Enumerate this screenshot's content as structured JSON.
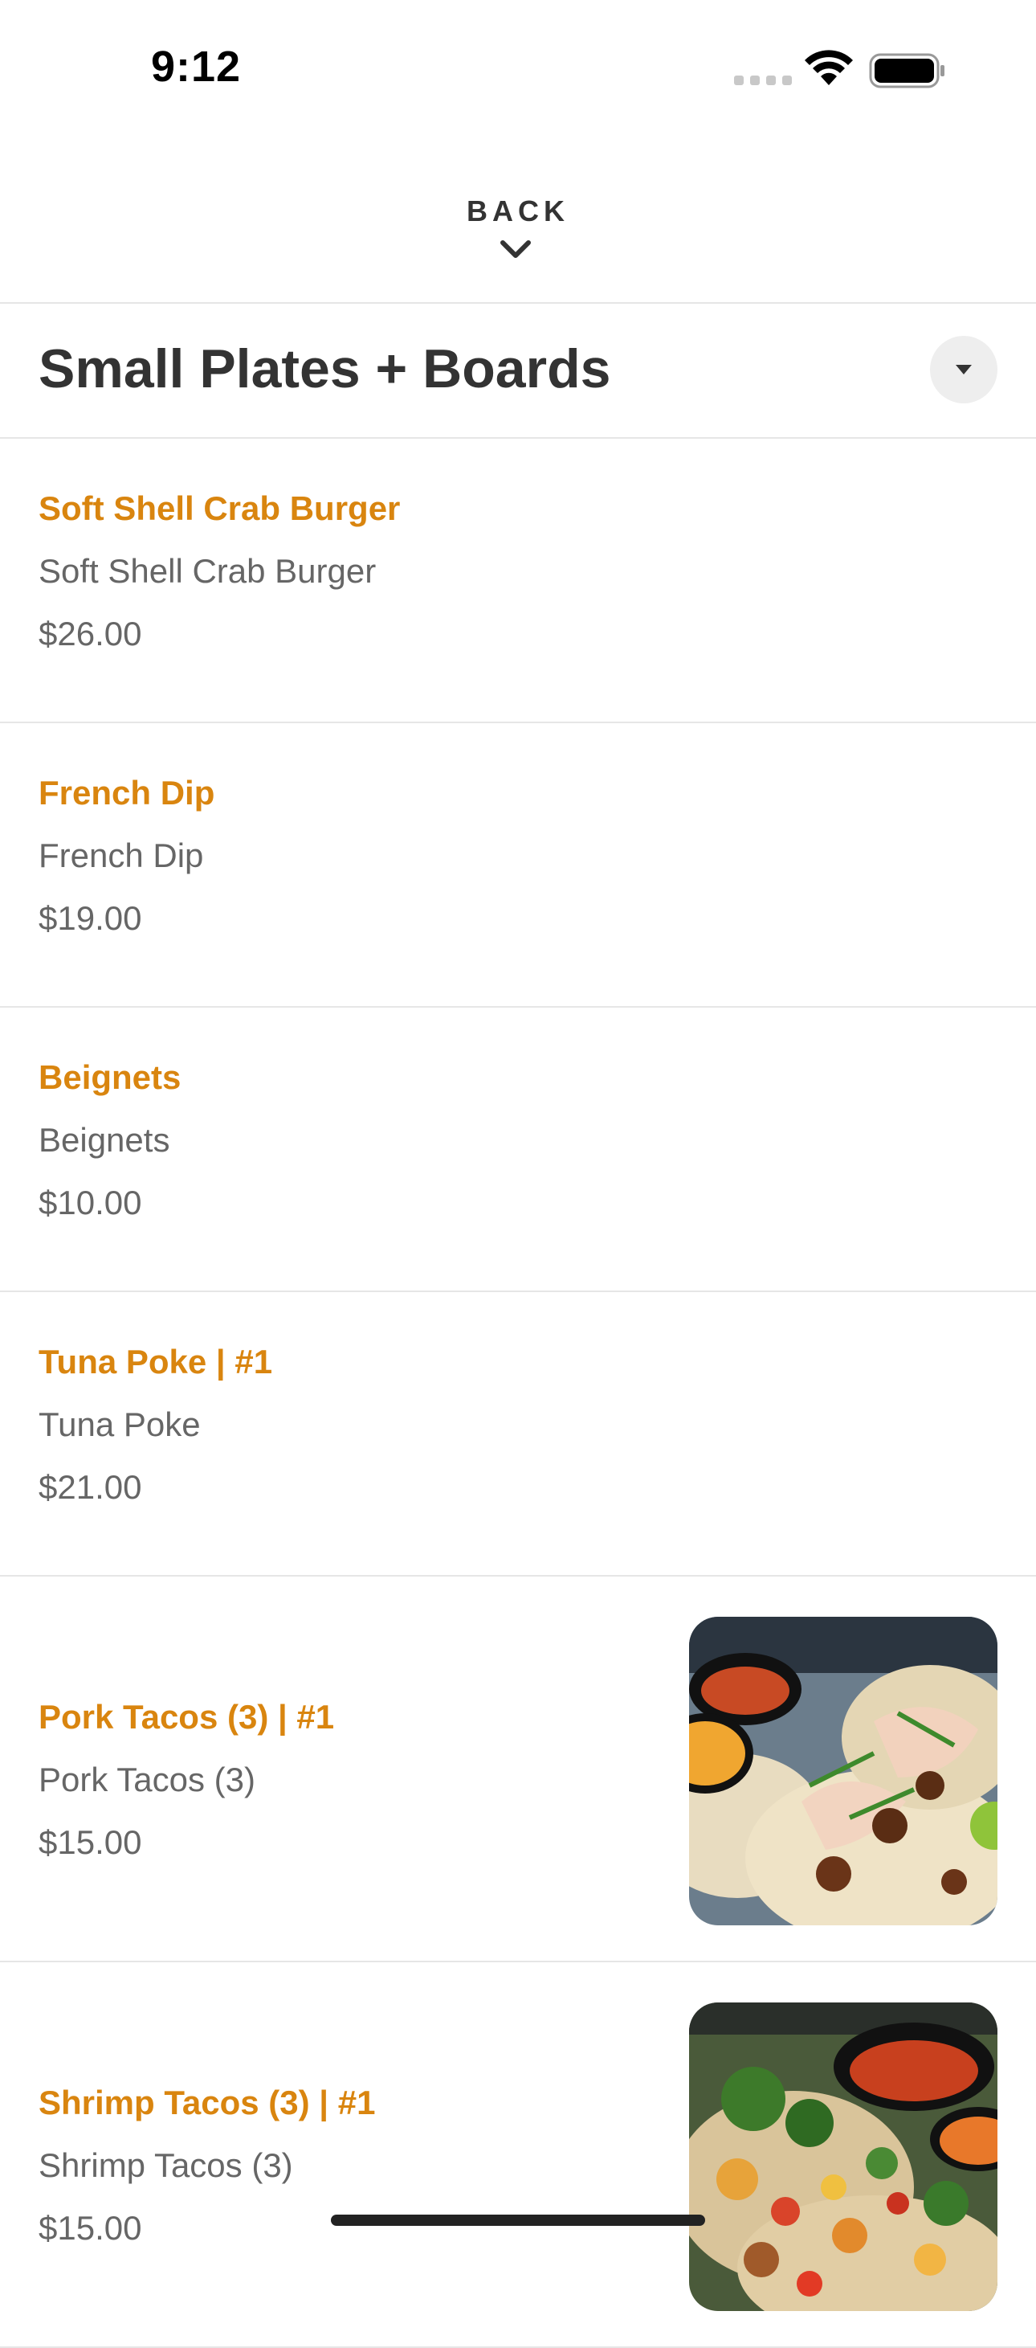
{
  "status_bar": {
    "time": "9:12"
  },
  "nav": {
    "back_label": "BACK"
  },
  "section": {
    "title": "Small Plates + Boards"
  },
  "menu_items": [
    {
      "name": "Soft Shell Crab Burger",
      "description": "Soft Shell Crab Burger",
      "price": "$26.00"
    },
    {
      "name": "French Dip",
      "description": "French Dip",
      "price": "$19.00"
    },
    {
      "name": "Beignets",
      "description": "Beignets",
      "price": "$10.00"
    },
    {
      "name": "Tuna Poke | #1",
      "description": "Tuna Poke",
      "price": "$21.00"
    },
    {
      "name": "Pork Tacos (3) | #1",
      "description": "Pork Tacos (3)",
      "price": "$15.00",
      "photo": "pork-tacos-photo"
    },
    {
      "name": "Shrimp Tacos (3) | #1",
      "description": "Shrimp Tacos (3)",
      "price": "$15.00",
      "photo": "shrimp-tacos-photo"
    }
  ],
  "colors": {
    "item_name": "#d9850f",
    "text_secondary": "#666666",
    "title": "#333333",
    "divider": "#e6e6e6"
  },
  "icons": {
    "wifi": "wifi-icon",
    "battery": "battery-icon",
    "back": "chevron-down-icon",
    "section_toggle": "triangle-down-icon"
  }
}
